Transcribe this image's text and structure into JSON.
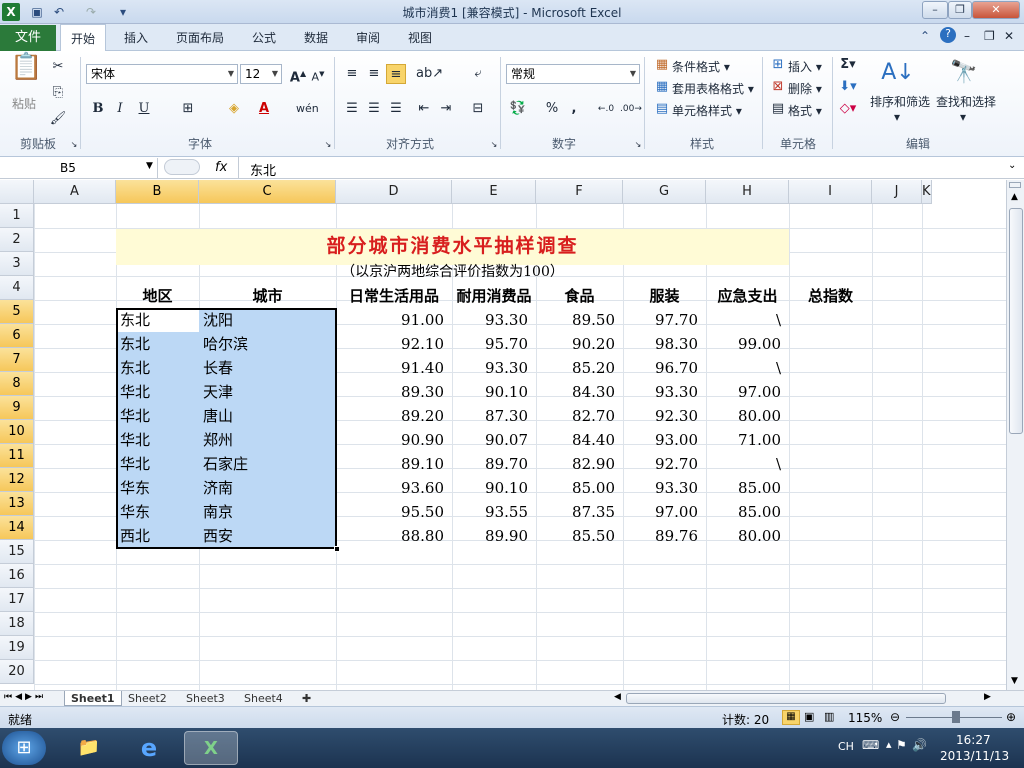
{
  "window": {
    "title": "城市消费1 [兼容模式] - Microsoft Excel",
    "quick_access": [
      "save-icon",
      "undo-icon",
      "redo-icon",
      "customize-icon"
    ],
    "controls": [
      "minimize",
      "restore",
      "close"
    ]
  },
  "ribbon_tabs": [
    "文件",
    "开始",
    "插入",
    "页面布局",
    "公式",
    "数据",
    "审阅",
    "视图"
  ],
  "active_tab": "开始",
  "ribbon": {
    "clipboard": {
      "label": "剪贴板",
      "paste": "粘贴"
    },
    "font": {
      "label": "字体",
      "name": "宋体",
      "size": "12",
      "bold": "B",
      "italic": "I",
      "underline": "U",
      "wen": "wén"
    },
    "alignment": {
      "label": "对齐方式"
    },
    "number": {
      "label": "数字",
      "format": "常规",
      "percent": "%",
      "comma": ","
    },
    "styles": {
      "label": "样式",
      "conditional": "条件格式",
      "table": "套用表格格式",
      "cell": "单元格样式"
    },
    "cells": {
      "label": "单元格",
      "insert": "插入",
      "delete": "删除",
      "format": "格式"
    },
    "editing": {
      "label": "编辑",
      "sort": "排序和筛选",
      "find": "查找和选择"
    }
  },
  "formula_bar": {
    "name_box": "B5",
    "fx": "fx",
    "content": "东北"
  },
  "columns": [
    "A",
    "B",
    "C",
    "D",
    "E",
    "F",
    "G",
    "H",
    "I",
    "J",
    "K"
  ],
  "rows": [
    "1",
    "2",
    "3",
    "4",
    "5",
    "6",
    "7",
    "8",
    "9",
    "10",
    "11",
    "12",
    "13",
    "14",
    "15",
    "16",
    "17",
    "18",
    "19",
    "20"
  ],
  "sheet": {
    "title": "部分城市消费水平抽样调查",
    "subtitle": "（以京沪两地综合评价指数为100）",
    "headers": [
      "地区",
      "城市",
      "日常生活用品",
      "耐用消费品",
      "食品",
      "服装",
      "应急支出",
      "总指数"
    ],
    "rows": [
      [
        "东北",
        "沈阳",
        "91.00",
        "93.30",
        "89.50",
        "97.70",
        "\\",
        ""
      ],
      [
        "东北",
        "哈尔滨",
        "92.10",
        "95.70",
        "90.20",
        "98.30",
        "99.00",
        ""
      ],
      [
        "东北",
        "长春",
        "91.40",
        "93.30",
        "85.20",
        "96.70",
        "\\",
        ""
      ],
      [
        "华北",
        "天津",
        "89.30",
        "90.10",
        "84.30",
        "93.30",
        "97.00",
        ""
      ],
      [
        "华北",
        "唐山",
        "89.20",
        "87.30",
        "82.70",
        "92.30",
        "80.00",
        ""
      ],
      [
        "华北",
        "郑州",
        "90.90",
        "90.07",
        "84.40",
        "93.00",
        "71.00",
        ""
      ],
      [
        "华北",
        "石家庄",
        "89.10",
        "89.70",
        "82.90",
        "92.70",
        "\\",
        ""
      ],
      [
        "华东",
        "济南",
        "93.60",
        "90.10",
        "85.00",
        "93.30",
        "85.00",
        ""
      ],
      [
        "华东",
        "南京",
        "95.50",
        "93.55",
        "87.35",
        "97.00",
        "85.00",
        ""
      ],
      [
        "西北",
        "西安",
        "88.80",
        "89.90",
        "85.50",
        "89.76",
        "80.00",
        ""
      ]
    ]
  },
  "sheet_tabs": [
    "Sheet1",
    "Sheet2",
    "Sheet3",
    "Sheet4"
  ],
  "active_sheet": "Sheet1",
  "status": {
    "ready": "就绪",
    "count": "计数: 20",
    "zoom": "115%"
  },
  "taskbar": {
    "lang": "CH",
    "time": "16:27",
    "date": "2013/11/13"
  }
}
